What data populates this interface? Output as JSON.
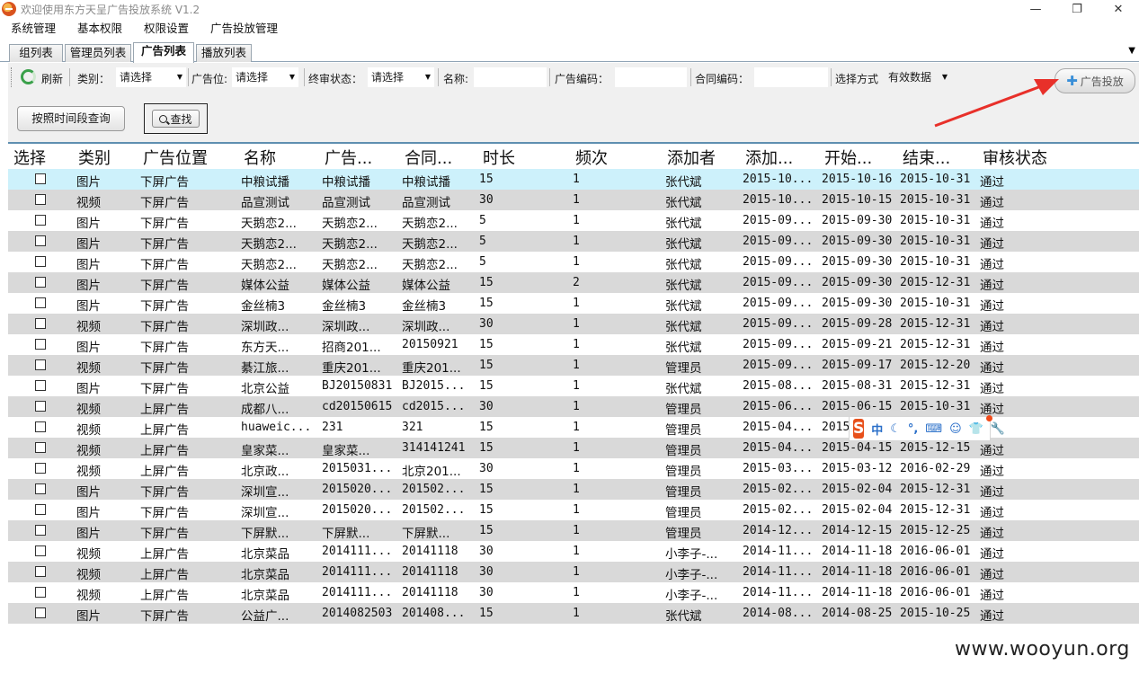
{
  "window": {
    "title": "欢迎使用东方天呈广告投放系统 V1.2",
    "controls": [
      "—",
      "❐",
      "✕"
    ]
  },
  "menu": [
    "系统管理",
    "基本权限",
    "权限设置",
    "广告投放管理"
  ],
  "tabs": [
    "组列表",
    "管理员列表",
    "广告列表",
    "播放列表"
  ],
  "active_tab": "广告列表",
  "toolbar": {
    "refresh_label": "刷新",
    "category_label": "类别：",
    "category_value": "请选择",
    "position_label": "广告位:",
    "position_value": "请选择",
    "review_label": "终审状态：",
    "review_value": "请选择",
    "name_label": "名称:",
    "adcode_label": "广告编码：",
    "contract_label": "合同编码：",
    "mode_label": "选择方式",
    "mode_value": "有效数据",
    "ad_button_label": "广告投放",
    "time_query_label": "按照时间段查询",
    "search_label": "查找"
  },
  "grid": {
    "headers": [
      "选择",
      "类别",
      "广告位置",
      "名称",
      "广告...",
      "合同...",
      "时长",
      "频次",
      "添加者",
      "添加...",
      "开始...",
      "结束...",
      "审核状态"
    ],
    "rows": [
      [
        "图片",
        "下屏广告",
        "中粮试播",
        "中粮试播",
        "中粮试播",
        "15",
        "1",
        "张代斌",
        "2015-10...",
        "2015-10-16",
        "2015-10-31",
        "通过"
      ],
      [
        "视频",
        "下屏广告",
        "品宣测试",
        "品宣测试",
        "品宣测试",
        "30",
        "1",
        "张代斌",
        "2015-10...",
        "2015-10-15",
        "2015-10-31",
        "通过"
      ],
      [
        "图片",
        "下屏广告",
        "天鹅恋2...",
        "天鹅恋2...",
        "天鹅恋2...",
        "5",
        "1",
        "张代斌",
        "2015-09...",
        "2015-09-30",
        "2015-10-31",
        "通过"
      ],
      [
        "图片",
        "下屏广告",
        "天鹅恋2...",
        "天鹅恋2...",
        "天鹅恋2...",
        "5",
        "1",
        "张代斌",
        "2015-09...",
        "2015-09-30",
        "2015-10-31",
        "通过"
      ],
      [
        "图片",
        "下屏广告",
        "天鹅恋2...",
        "天鹅恋2...",
        "天鹅恋2...",
        "5",
        "1",
        "张代斌",
        "2015-09...",
        "2015-09-30",
        "2015-10-31",
        "通过"
      ],
      [
        "图片",
        "下屏广告",
        "媒体公益",
        "媒体公益",
        "媒体公益",
        "15",
        "2",
        "张代斌",
        "2015-09...",
        "2015-09-30",
        "2015-12-31",
        "通过"
      ],
      [
        "图片",
        "下屏广告",
        "金丝楠3",
        "金丝楠3",
        "金丝楠3",
        "15",
        "1",
        "张代斌",
        "2015-09...",
        "2015-09-30",
        "2015-10-31",
        "通过"
      ],
      [
        "视频",
        "下屏广告",
        "深圳政...",
        "深圳政...",
        "深圳政...",
        "30",
        "1",
        "张代斌",
        "2015-09...",
        "2015-09-28",
        "2015-12-31",
        "通过"
      ],
      [
        "图片",
        "下屏广告",
        "东方天...",
        "招商201...",
        "20150921",
        "15",
        "1",
        "张代斌",
        "2015-09...",
        "2015-09-21",
        "2015-12-31",
        "通过"
      ],
      [
        "视频",
        "下屏广告",
        "綦江旅...",
        "重庆201...",
        "重庆201...",
        "15",
        "1",
        "管理员",
        "2015-09...",
        "2015-09-17",
        "2015-12-20",
        "通过"
      ],
      [
        "图片",
        "下屏广告",
        "北京公益",
        "BJ20150831",
        "BJ2015...",
        "15",
        "1",
        "张代斌",
        "2015-08...",
        "2015-08-31",
        "2015-12-31",
        "通过"
      ],
      [
        "视频",
        "上屏广告",
        "成都八...",
        "cd20150615",
        "cd2015...",
        "30",
        "1",
        "管理员",
        "2015-06...",
        "2015-06-15",
        "2015-10-31",
        "通过"
      ],
      [
        "视频",
        "上屏广告",
        "huaweic...",
        "231",
        "321",
        "15",
        "1",
        "管理员",
        "2015-04...",
        "2015",
        "",
        ""
      ],
      [
        "视频",
        "上屏广告",
        "皇家菜...",
        "皇家菜...",
        "314141241",
        "15",
        "1",
        "管理员",
        "2015-04...",
        "2015-04-15",
        "2015-12-15",
        "通过"
      ],
      [
        "视频",
        "上屏广告",
        "北京政...",
        "2015031...",
        "北京201...",
        "30",
        "1",
        "管理员",
        "2015-03...",
        "2015-03-12",
        "2016-02-29",
        "通过"
      ],
      [
        "图片",
        "下屏广告",
        "深圳宣...",
        "2015020...",
        "201502...",
        "15",
        "1",
        "管理员",
        "2015-02...",
        "2015-02-04",
        "2015-12-31",
        "通过"
      ],
      [
        "图片",
        "下屏广告",
        "深圳宣...",
        "2015020...",
        "201502...",
        "15",
        "1",
        "管理员",
        "2015-02...",
        "2015-02-04",
        "2015-12-31",
        "通过"
      ],
      [
        "图片",
        "下屏广告",
        "下屏默...",
        "下屏默...",
        "下屏默...",
        "15",
        "1",
        "管理员",
        "2014-12...",
        "2014-12-15",
        "2015-12-25",
        "通过"
      ],
      [
        "视频",
        "上屏广告",
        "北京菜品",
        "2014111...",
        "20141118",
        "30",
        "1",
        "小李子-...",
        "2014-11...",
        "2014-11-18",
        "2016-06-01",
        "通过"
      ],
      [
        "视频",
        "上屏广告",
        "北京菜品",
        "2014111...",
        "20141118",
        "30",
        "1",
        "小李子-...",
        "2014-11...",
        "2014-11-18",
        "2016-06-01",
        "通过"
      ],
      [
        "视频",
        "上屏广告",
        "北京菜品",
        "2014111...",
        "20141118",
        "30",
        "1",
        "小李子-...",
        "2014-11...",
        "2014-11-18",
        "2016-06-01",
        "通过"
      ],
      [
        "图片",
        "下屏广告",
        "公益广...",
        "2014082503",
        "201408...",
        "15",
        "1",
        "张代斌",
        "2014-08...",
        "2014-08-25",
        "2015-10-25",
        "通过"
      ]
    ]
  },
  "ime": {
    "logo": "S",
    "items": [
      "中",
      "☾",
      "°,",
      "⌨",
      "☺",
      "👕",
      "🔧"
    ]
  },
  "watermark": "www.wooyun.org",
  "colors": {
    "selected_row": "#cdf1fb",
    "alt_row": "#d9d9d9",
    "arrow": "#e8302a",
    "header_rule": "#5f8fb0"
  }
}
